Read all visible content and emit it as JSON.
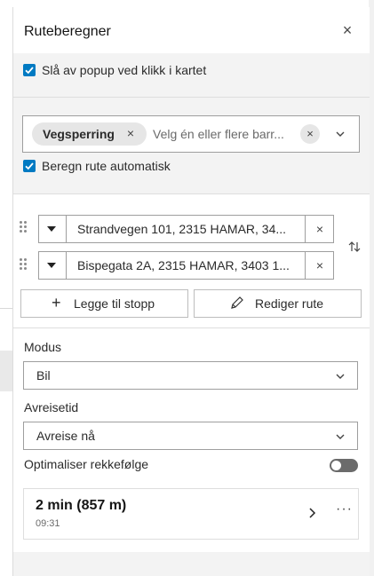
{
  "panel": {
    "title": "Ruteberegner",
    "close_icon": "close-icon"
  },
  "options": {
    "disable_popup": {
      "label": "Slå av popup ved klikk i kartet",
      "checked": true
    }
  },
  "barriers": {
    "chip_label": "Vegsperring",
    "placeholder": "Velg én eller flere barr...",
    "auto_calc": {
      "label": "Beregn rute automatisk",
      "checked": true
    }
  },
  "stops": [
    {
      "address": "Strandvegen 101, 2315 HAMAR, 34..."
    },
    {
      "address": "Bispegata 2A, 2315 HAMAR, 3403 1..."
    }
  ],
  "actions": {
    "add_stop": "Legge til stopp",
    "edit_route": "Rediger rute"
  },
  "mode": {
    "label": "Modus",
    "value": "Bil"
  },
  "departure": {
    "label": "Avreisetid",
    "value": "Avreise nå"
  },
  "optimize": {
    "label": "Optimaliser rekkefølge",
    "on": false
  },
  "result": {
    "summary": "2 min (857 m)",
    "time": "09:31"
  },
  "colors": {
    "accent": "#007ac2",
    "toggle_off": "#6b6b6b",
    "section_bg": "#f3f3f3"
  }
}
